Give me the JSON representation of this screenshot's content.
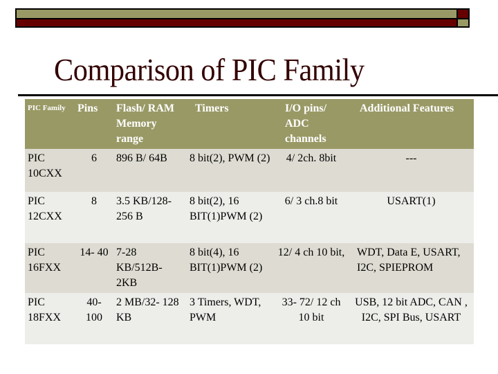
{
  "slide": {
    "title": "Comparison of PIC Family",
    "colors": {
      "olive": "#999966",
      "maroon": "#660000",
      "title": "#330000"
    }
  },
  "table": {
    "headers": [
      "PIC Family",
      "Pins",
      "Flash/ RAM Memory range",
      "Timers",
      "I/O pins/ ADC channels",
      "Additional Features"
    ],
    "rows": [
      [
        "PIC 10CXX",
        "6",
        "896 B/ 64B",
        "8 bit(2), PWM (2)",
        "4/ 2ch. 8bit",
        "---"
      ],
      [
        "PIC 12CXX",
        "8",
        "3.5 KB/128- 256 B",
        "8 bit(2), 16 BIT(1)PWM (2)",
        "6/ 3 ch.8 bit",
        "USART(1)"
      ],
      [
        "PIC 16FXX",
        "14- 40",
        "7-28 KB/512B- 2KB",
        "8 bit(4), 16 BIT(1)PWM (2)",
        "12/ 4 ch 10 bit,",
        "WDT, Data E, USART, I2C, SPIEPROM"
      ],
      [
        "PIC 18FXX",
        "40- 100",
        "2 MB/32- 128 KB",
        "3 Timers, WDT, PWM",
        "33- 72/ 12 ch 10 bit",
        "USB, 12 bit ADC, CAN , I2C, SPI Bus, USART"
      ]
    ]
  }
}
